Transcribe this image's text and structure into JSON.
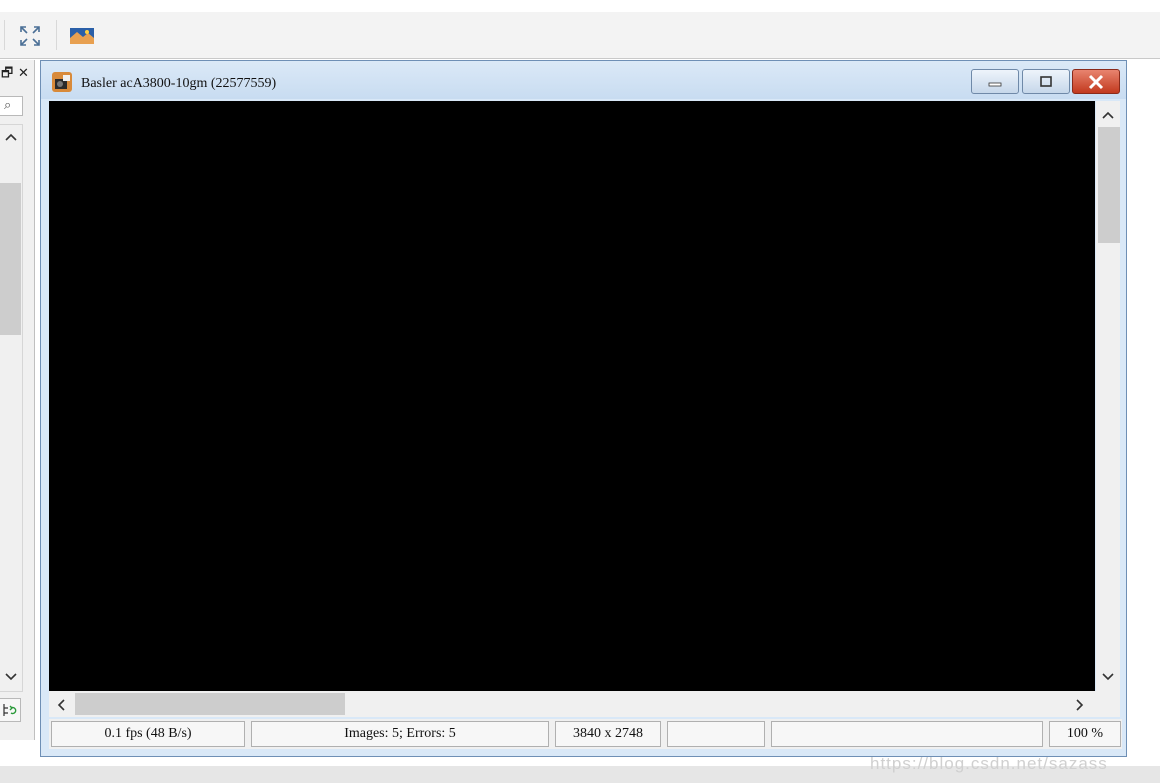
{
  "toolbar": {
    "icons": [
      "fullscreen-icon",
      "image-icon"
    ]
  },
  "left_panel": {
    "restore_glyph": "🗗",
    "close_glyph": "✕",
    "search_glyph": "⌕",
    "up_glyph": "^",
    "down_glyph": "v",
    "bottom_icon": "refresh-tree-icon"
  },
  "camera_window": {
    "title": "Basler acA3800-10gm (22577559)",
    "status": {
      "fps": "0.1 fps (48 B/s)",
      "images": "Images: 5; Errors: 5",
      "resolution": "3840 x 2748",
      "empty1": "",
      "empty2": "",
      "zoom": "100 %"
    }
  },
  "watermark": "https://blog.csdn.net/sazass",
  "colors": {
    "titlebar": "#c8dcf1",
    "close_button": "#c2391e",
    "viewport": "#000000"
  }
}
